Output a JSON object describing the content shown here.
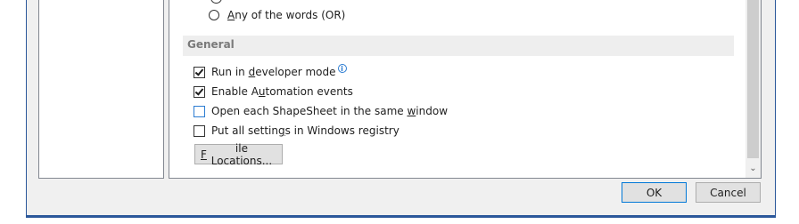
{
  "search_options": {
    "any_words_label": "Any of the words (OR)"
  },
  "section_general": {
    "title": "General"
  },
  "options": [
    {
      "label": "Run in developer mode",
      "checked": true,
      "info_icon": "info-icon"
    },
    {
      "label": "Enable Automation events",
      "checked": true
    },
    {
      "label": "Open each ShapeSheet in the same window",
      "checked": false
    },
    {
      "label": "Put all settings in Windows registry",
      "checked": false
    }
  ],
  "buttons": {
    "file_locations": "File Locations...",
    "ok": "OK",
    "cancel": "Cancel"
  },
  "colors": {
    "accent": "#2b579a",
    "focus": "#0078d7",
    "section_bg": "#eeeeee"
  }
}
